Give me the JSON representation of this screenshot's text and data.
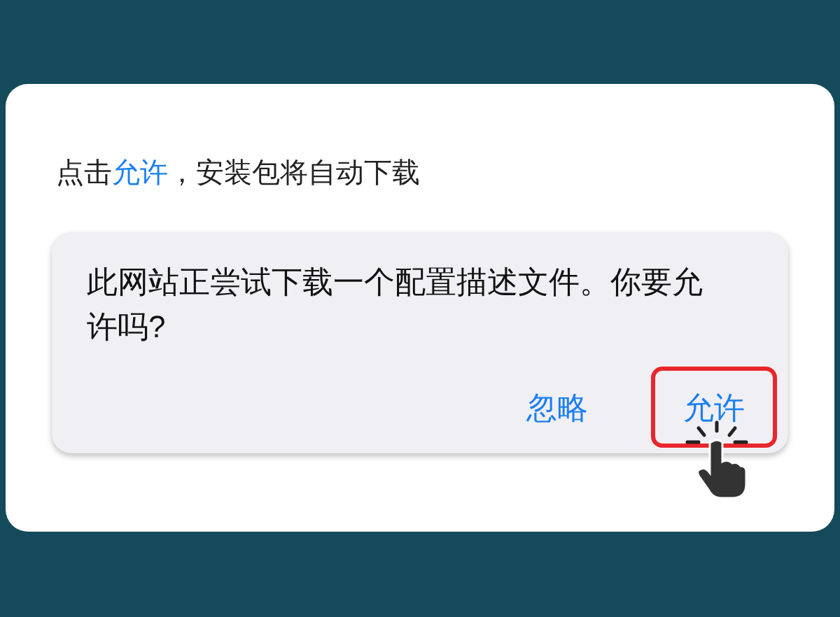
{
  "instruction": {
    "parts": [
      {
        "text": "点击",
        "highlight": false
      },
      {
        "text": "允许",
        "highlight": true
      },
      {
        "text": "，安装包将自动下载",
        "highlight": false
      }
    ]
  },
  "dialog": {
    "message": "此网站正尝试下载一个配置描述文件。你要允许吗?",
    "buttons": [
      {
        "label": "忽略",
        "marked": false
      },
      {
        "label": "允许",
        "marked": true
      }
    ]
  }
}
